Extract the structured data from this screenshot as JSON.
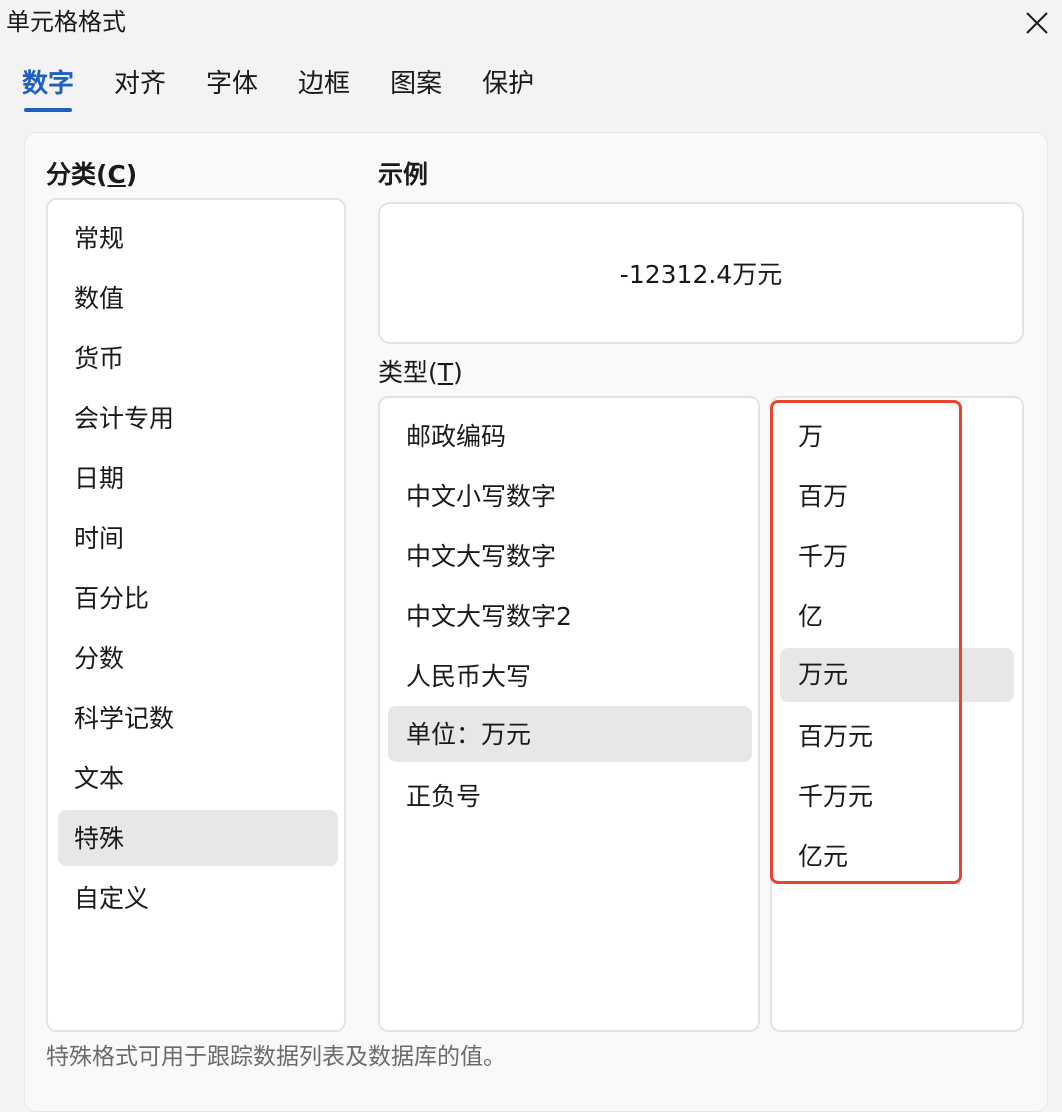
{
  "dialog": {
    "title": "单元格格式"
  },
  "tabs": [
    {
      "label": "数字"
    },
    {
      "label": "对齐"
    },
    {
      "label": "字体"
    },
    {
      "label": "边框"
    },
    {
      "label": "图案"
    },
    {
      "label": "保护"
    }
  ],
  "category": {
    "label_prefix": "分类(",
    "label_key": "C",
    "label_suffix": ")",
    "items": [
      "常规",
      "数值",
      "货币",
      "会计专用",
      "日期",
      "时间",
      "百分比",
      "分数",
      "科学记数",
      "文本",
      "特殊",
      "自定义"
    ],
    "selected": "特殊"
  },
  "sample": {
    "label": "示例",
    "value": "-12312.4万元"
  },
  "type": {
    "label_prefix": "类型(",
    "label_key": "T",
    "label_suffix": ")",
    "items": [
      "邮政编码",
      "中文小写数字",
      "中文大写数字",
      "中文大写数字2",
      "人民币大写",
      "单位：万元",
      "正负号"
    ],
    "selected": "单位：万元"
  },
  "unit": {
    "items": [
      "万",
      "百万",
      "千万",
      "亿",
      "万元",
      "百万元",
      "千万元",
      "亿元"
    ],
    "selected": "万元"
  },
  "footer": {
    "description": "特殊格式可用于跟踪数据列表及数据库的值。"
  },
  "colors": {
    "accent": "#1f5fbf",
    "highlight": "#e8442e",
    "selected_bg": "#e7e7e7"
  }
}
